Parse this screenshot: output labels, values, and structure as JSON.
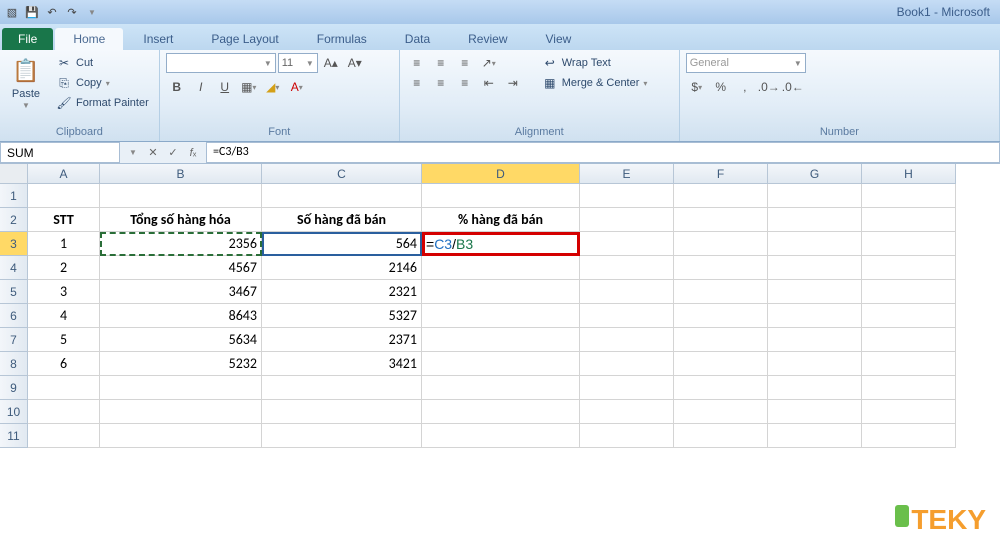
{
  "window": {
    "title": "Book1 - Microsoft"
  },
  "qat": [
    "💾",
    "↶",
    "↷"
  ],
  "file_tab": "File",
  "tabs": [
    "Home",
    "Insert",
    "Page Layout",
    "Formulas",
    "Data",
    "Review",
    "View"
  ],
  "active_tab": 0,
  "ribbon": {
    "clipboard": {
      "label": "Clipboard",
      "paste": "Paste",
      "cut": "Cut",
      "copy": "Copy",
      "fp": "Format Painter"
    },
    "font": {
      "label": "Font",
      "font_name": "",
      "size": "11"
    },
    "alignment": {
      "label": "Alignment",
      "wrap": "Wrap Text",
      "merge": "Merge & Center"
    },
    "number": {
      "label": "Number",
      "format": "General"
    }
  },
  "name_box": "SUM",
  "formula": {
    "prefix": "=",
    "ref1": "C3",
    "op": "/",
    "ref2": "B3"
  },
  "formula_plain": "=C3/B3",
  "columns": [
    "A",
    "B",
    "C",
    "D",
    "E",
    "F",
    "G",
    "H"
  ],
  "rows": [
    "1",
    "2",
    "3",
    "4",
    "5",
    "6",
    "7",
    "8",
    "9",
    "10",
    "11"
  ],
  "headers": {
    "A": "STT",
    "B": "Tổng số hàng hóa",
    "C": "Số hàng đã bán",
    "D": "% hàng đã bán"
  },
  "data": [
    {
      "stt": "1",
      "b": "2356",
      "c": "564",
      "d_formula": "=C3/B3"
    },
    {
      "stt": "2",
      "b": "4567",
      "c": "2146"
    },
    {
      "stt": "3",
      "b": "3467",
      "c": "2321"
    },
    {
      "stt": "4",
      "b": "8643",
      "c": "5327"
    },
    {
      "stt": "5",
      "b": "5634",
      "c": "2371"
    },
    {
      "stt": "6",
      "b": "5232",
      "c": "3421"
    }
  ],
  "logo_text": "TEKY"
}
